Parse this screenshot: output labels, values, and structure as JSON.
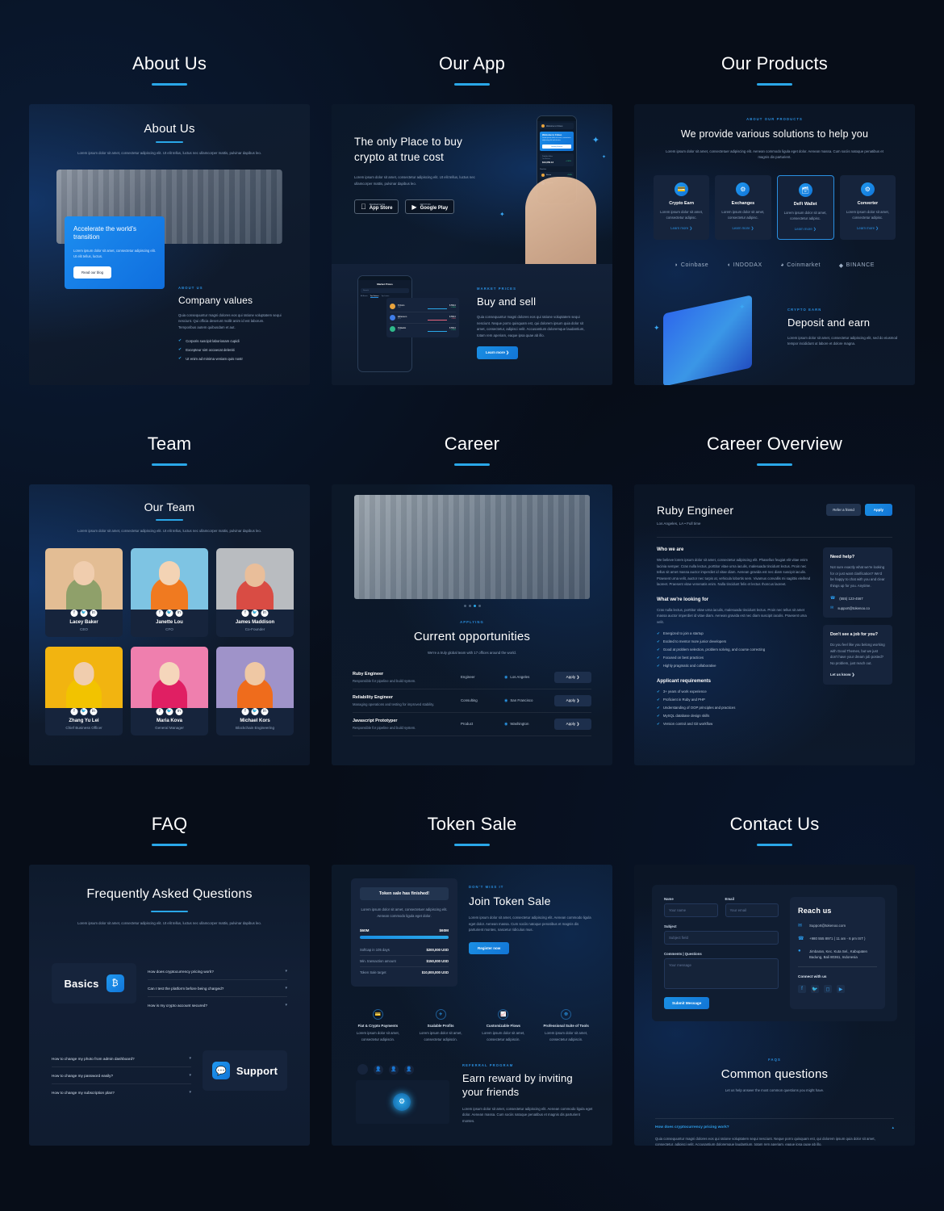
{
  "meta": {
    "accent": "#2aa7e8",
    "blue": "#1a8fe3",
    "bg": "#070d18"
  },
  "sections": [
    {
      "id": "about-us",
      "title": "About Us"
    },
    {
      "id": "our-app",
      "title": "Our App"
    },
    {
      "id": "our-products",
      "title": "Our Products"
    },
    {
      "id": "team",
      "title": "Team"
    },
    {
      "id": "career",
      "title": "Career"
    },
    {
      "id": "career-overview",
      "title": "Career Overview"
    },
    {
      "id": "faq",
      "title": "FAQ"
    },
    {
      "id": "token-sale",
      "title": "Token Sale"
    },
    {
      "id": "contact-us",
      "title": "Contact Us"
    }
  ],
  "lorem": {
    "short": "Lorem ipsum dolor sit amet, consectetur adipiscing elit. Ut elit tellus, luctus nec ullamcorper mattis, pulvinar dapibus leo.",
    "card": "Lorem ipsum dolor sit amet, consectetur adipiscin.",
    "para": "Quia consequuntur magni dolores eos qui ratione voluptatem sequi nesciunt. Qui officia deserunt mollit anim id est laborum. Temporibus autem quibusdam et aut.",
    "para2": "Quia consequuntur magni dolores eos qui ratione voluptatem sequi nesciunt. Neque porro quisquam est, qui dolorem ipsum quia dolor sit amet, consectetur, adipisci velit. Accusantium doloremque laudantium, totam rem aperiam, eaque ipsa quae ab illo.",
    "products": "Lorem ipsum dolor sit amet, consectetuer adipiscing elit. Aenean commodo ligula eget dolor. Aenean massa. Cum sociis natoque penatibus et magnis dis parturient.",
    "smallcard": "Lorem ipsum dolor sit amet, consectetur adipiscin.",
    "blue": "Lorem ipsum dolor sit amet, consectetur adipiscing elit. Ut elit tellus, luctus.",
    "deposit": "Lorem ipsum dolor sit amet, consectetur adipiscing elit, sed do eiusmod tempor incididunt ut labore et dolore magna.",
    "token": "Lorem ipsum dolor sit amet, consectetur adipiscing elit. Aenean commodo ligula eget dolor. Aenean massa. Cum sociis natoque penatibus et magnis dis parturient montes, nascetur ridiculus mus.",
    "tokenbox": "Lorem ipsum dolor sit amet, consectetuer adipiscing elit. Aenean commodo ligula eget dolor.",
    "referral": "Lorem ipsum dolor sit amet, consectetur adipiscing elit. Aenean commodo ligula eget dolor. Aenean massa. Cum sociis natoque penatibus et magnis dis parturient montes.",
    "faqanswer": "Quia consequuntur magni dolores eos qui ratione voluptatem sequi nesciunt. Neque porro quisquam est, qui dolorem ipsum quia dolor sit amet, consectetur, adipisci velit. Accusantium doloremque laudantium, totam rem aperiam, eaque ipsa quae ab illo."
  },
  "about": {
    "heading": "About Us",
    "subtitle": "Lorem ipsum dolor sit amet, consectetur adipiscing elit. Ut elit tellus, luctus nec ullamcorper mattis, pulvinar dapibus leo.",
    "blue_card": {
      "title": "Accelerate the world's transition",
      "body": "Lorem ipsum dolor sit amet, consectetur adipiscing elit. Ut elit tellus, luctus.",
      "button": "Read our blog"
    },
    "eyebrow": "ABOUT US",
    "title": "Company values",
    "body": "Quia consequuntur magni dolores eos qui ratione voluptatem sequi nesciunt. Qui officia deserunt mollit anim id est laborum. Temporibus autem quibusdam et aut.",
    "bullets": [
      "Corporis suscipit laboriosam cupidi",
      "Excepteur sint occaecat deleniti",
      "Ut enim ad minima veniam quis nostr"
    ]
  },
  "app": {
    "hero_title": "The only Place to buy crypto at true cost",
    "hero_body": "Lorem ipsum dolor sit amet, consectetur adipiscing elit. Ut elit tellus, luctus nec ullamcorper mattis, pulvinar dapibus leo.",
    "store_buttons": [
      {
        "small": "Download on the",
        "big": "App Store",
        "icon": "apple-icon"
      },
      {
        "small": "GET IT ON",
        "big": "Google Play",
        "icon": "play-icon"
      }
    ],
    "phone": {
      "welcome_title": "Welcome to Crineo",
      "welcome_body": "Lorem ipsum dolor sit amet, consectetur adipiscing elit sed do eius",
      "welcome_button": "Getting Started",
      "portfolio_label": "Portfolio Value",
      "portfolio_sub": "Total Balance",
      "portfolio_value": "$13,056.12",
      "portfolio_change": "+2.45%",
      "watchlist_label": "Watchlist",
      "coins": [
        {
          "name": "Bitcoin",
          "ticker": "BTC",
          "price": "$ 550.0",
          "change": "+2.06%"
        },
        {
          "name": "Ethereum",
          "ticker": "ETH",
          "price": "$ 550.0",
          "change": "-1.04%"
        }
      ]
    },
    "market": {
      "title": "Market Prices",
      "search_placeholder": "Search",
      "tabs": [
        "All Assets",
        "Top Gainers",
        "Top Losers"
      ],
      "rows": [
        {
          "name": "TriCoin",
          "ticker": "TRC",
          "price": "$ 550.0",
          "change": "+2.06%"
        },
        {
          "name": "Ethereum",
          "ticker": "ETH",
          "price": "$ 550.0",
          "change": "-1.04%"
        },
        {
          "name": "Polkadot",
          "ticker": "DOT",
          "price": "$ 550.0",
          "change": "+2.06%"
        }
      ]
    },
    "section": {
      "eyebrow": "MARKET PRICES",
      "title": "Buy and sell",
      "body": "Quia consequuntur magni dolores eos qui ratione voluptatem sequi nesciunt. Neque porro quisquam est, qui dolorem ipsum quia dolor sit amet, consectetur, adipisci velit. Accusantium doloremque laudantium, totam rem aperiam, eaque ipsa quae ab illo.",
      "button": "Learn more"
    }
  },
  "products": {
    "eyebrow": "ABOUT OUR PRODUCTS",
    "title": "We provide various solutions to help you",
    "body": "Lorem ipsum dolor sit amet, consectetuer adipiscing elit. Aenean commodo ligula eget dolor. Aenean massa. Cum sociis natoque penatibus et magnis dis parturient.",
    "cards": [
      {
        "name": "Crypto Earn",
        "body": "Lorem ipsum dolor sit amet, consectetur adipisc.",
        "link": "Learn more",
        "icon": "wallet-icon",
        "active": false
      },
      {
        "name": "Exchanges",
        "body": "Lorem ipsum dolor sit amet, consectetur adipisc.",
        "link": "Learn more",
        "icon": "exchange-icon",
        "active": false
      },
      {
        "name": "DeFi Wallet",
        "body": "Lorem ipsum dolor sit amet, consectetur adipisc.",
        "link": "Learn more",
        "icon": "safe-icon",
        "active": true
      },
      {
        "name": "Converter",
        "body": "Lorem ipsum dolor sit amet, consectetur adipisc.",
        "link": "Learn more",
        "icon": "convert-icon",
        "active": false
      }
    ],
    "logos": [
      "Coinbase",
      "INDODAX",
      "Coinmarket",
      "BINANCE"
    ],
    "deposit": {
      "eyebrow": "CRYPTO EARN",
      "title": "Deposit and earn",
      "body": "Lorem ipsum dolor sit amet, consectetur adipiscing elit, sed do eiusmod tempor incididunt ut labore et dolore magna."
    }
  },
  "team": {
    "heading": "Our Team",
    "subtitle": "Lorem ipsum dolor sit amet, consectetur adipiscing elit. Ut elit tellus, luctus nec ullamcorper mattis, pulvinar dapibus leo.",
    "members": [
      {
        "name": "Lacey Baker",
        "role": "CEO",
        "bg": "#e3bd94",
        "skin": "#f0cdae",
        "shirt": "#8fa06a"
      },
      {
        "name": "Janette Lou",
        "role": "CFO",
        "bg": "#7ec4e3",
        "skin": "#f3d3b4",
        "shirt": "#f07a20"
      },
      {
        "name": "James Maddison",
        "role": "Co-Founder",
        "bg": "#b9bcc0",
        "skin": "#e9be9a",
        "shirt": "#d94c44"
      },
      {
        "name": "Zhang Yu Lei",
        "role": "Chief Business Officer",
        "bg": "#f2b410",
        "skin": "#f0cdae",
        "shirt": "#f2c300"
      },
      {
        "name": "Maria Kova",
        "role": "General Manager",
        "bg": "#ef7fae",
        "skin": "#f5d6bb",
        "shirt": "#e01f63"
      },
      {
        "name": "Michael Kors",
        "role": "Blockchain Engineering",
        "bg": "#9f93c9",
        "skin": "#efc8a4",
        "shirt": "#ef6c1c"
      }
    ],
    "social_icons": [
      "facebook-icon",
      "twitter-icon",
      "linkedin-icon"
    ]
  },
  "career": {
    "eyebrow": "APPLYING",
    "title": "Current opportunities",
    "subtitle": "We're a truly global team with 17 offices around the world.",
    "jobs": [
      {
        "title": "Ruby Engineer",
        "desc": "Responsible for pipeline and build system.",
        "dept": "Engineer",
        "location": "Los Angeles",
        "button": "Apply"
      },
      {
        "title": "Reliability Engineer",
        "desc": "Managing operations and testing for improved stability.",
        "dept": "Consulting",
        "location": "San Francisco",
        "button": "Apply"
      },
      {
        "title": "Javascript Prototyper",
        "desc": "Responsible for pipeline and build system.",
        "dept": "Product",
        "location": "Washington",
        "button": "Apply"
      }
    ]
  },
  "career_overview": {
    "job_title": "Ruby Engineer",
    "job_meta": "Los Angeles, LA  •  Full time",
    "refer_button": "Refer a friend",
    "apply_button": "Apply",
    "who_title": "Who we are",
    "who_body": "We believe lorem ipsum dolor sit amet, consectetur adipiscing elit. Phasellus feugiat elit vitae enim lacinia semper. Cras nulla lectus, porttitor vitae urna iaculis, malesuada tincidunt lectus. Proin nec tellus sit amet massa auctor imperdiet id vitae diam. Aenean gravida est nec diam suscipit iaculis. Praesent urna velit, auctor nec turpis at, vehicula lobortis sem. Vivamus convallis mi sagittis eleifend laoreet. Praesent vitae venenatis enim. Nulla tincidunt felis et lectus rhoncus laoreet.",
    "looking_title": "What we're looking for",
    "looking_body": "Cras nulla lectus, porttitor vitae urna iaculis, malesuada tincidunt lectus. Proin nec tellus sit amet massa auctor imperdiet id vitae diam. Aenean gravida est nec diam suscipit iaculis. Praesent urna velit.",
    "looking_items": [
      "Energized to join a startup",
      "Excited to mentor more junior developers",
      "Good at problem selection, problem solving, and course correcting",
      "Focused on best practices",
      "Highly pragmatic and collaborative"
    ],
    "req_title": "Applicant requirements",
    "req_items": [
      "3+ years of work experience",
      "Proficient in Ruby and PHP",
      "Understanding of OOP principles and practices",
      "MySQL database design skills",
      "Version control and Git workflow"
    ],
    "help_title": "Need help?",
    "help_body": "Not sure exactly what we're looking for or just want clarification? We'd be happy to chat with you and clear things up for you. Anytime.",
    "help_phone": "(555) 123-4567",
    "help_email": "support@tokenoo.co",
    "nojob_title": "Don't see a job for you?",
    "nojob_body": "Do you feel like you belong working with Good Themes, but we just don't have your dream job posted? No problem, just reach out.",
    "nojob_link": "Let us know"
  },
  "faq": {
    "heading": "Frequently Asked Questions",
    "subtitle": "Lorem ipsum dolor sit amet, consectetur adipiscing elit. Ut elit tellus, luctus nec ullamcorper mattis, pulvinar dapibus leo.",
    "basics_label": "Basics",
    "basics_icon": "bitcoin-icon",
    "basics_questions": [
      "How does cryptocurrency pricing work?",
      "Can I test the platform before being charged?",
      "How is my crypto account secured?"
    ],
    "support_label": "Support",
    "support_icon": "chat-help-icon",
    "support_questions": [
      "How to change my photo from admin dashboard?",
      "How to change my password easily?",
      "How to change my subscription plan?"
    ]
  },
  "token_sale": {
    "box": {
      "badge": "Token sale has finished!",
      "body": "Lorem ipsum dolor sit amet, consectetuer adipiscing elit. Aenean commodo ligula eget dolor.",
      "progress_left": "$60M",
      "progress_right": "$60M",
      "progress_percent": 100,
      "stats": [
        {
          "label": "Softcap in 105 days",
          "value": "$200,000 USD"
        },
        {
          "label": "Min. transaction amount",
          "value": "$150,000 USD"
        },
        {
          "label": "Token Sale target",
          "value": "$10,000,000 USD"
        }
      ]
    },
    "eyebrow": "DON'T MISS IT",
    "title": "Join Token Sale",
    "body": "Lorem ipsum dolor sit amet, consectetur adipiscing elit. Aenean commodo ligula eget dolor. Aenean massa. Cum sociis natoque penatibus et magnis dis parturient montes, nascetur ridiculus mus.",
    "button": "Register now",
    "features": [
      {
        "name": "Fiat & Crypto Payments",
        "body": "Lorem ipsum dolor sit amet, consectetur adipiscin.",
        "icon": "card-icon"
      },
      {
        "name": "Scalable Profits",
        "body": "Lorem ipsum dolor sit amet, consectetur adipiscin.",
        "icon": "rocket-icon"
      },
      {
        "name": "Customizable Flows",
        "body": "Lorem ipsum dolor sit amet, consectetur adipiscin.",
        "icon": "chart-icon"
      },
      {
        "name": "Professional Suite of Tools",
        "body": "Lorem ipsum dolor sit amet, consectetur adipiscin.",
        "icon": "puzzle-icon"
      }
    ],
    "referral": {
      "eyebrow": "REFERRAL PROGRAM",
      "title": "Earn reward by inviting your friends",
      "body": "Lorem ipsum dolor sit amet, consectetur adipiscing elit. Aenean commodo ligula eget dolor. Aenean massa. Cum sociis natoque penatibus et magnis dis parturient montes."
    }
  },
  "contact": {
    "form": {
      "name_label": "Name",
      "name_placeholder": "Your name",
      "email_label": "Email",
      "email_placeholder": "Your email",
      "subject_label": "Subject",
      "subject_placeholder": "Subject field",
      "message_label": "Comments | Questions",
      "message_placeholder": "Your message",
      "submit": "Submit Message"
    },
    "reach": {
      "title": "Reach us",
      "email": "Support@tokenoo.com",
      "phone": "+980 555 8971 ( 11 am - 6 pm IST )",
      "address": "Jimbaran, Kec. Kuta Sel., Kabupaten Badung, Bali 80361, Indonesia",
      "connect_label": "Connect with us",
      "socials": [
        "facebook-icon",
        "twitter-icon",
        "instagram-icon",
        "youtube-icon"
      ]
    },
    "faq": {
      "eyebrow": "FAQS",
      "title": "Common questions",
      "subtitle": "Let us help answer the most common questions you might have.",
      "open_question": "How does cryptocurrency pricing work?",
      "open_answer": "Quia consequuntur magni dolores eos qui ratione voluptatem sequi nesciunt. Neque porro quisquam est, qui dolorem ipsum quia dolor sit amet, consectetur, adipisci velit. Accusantium doloremque laudantium, totam rem aperiam, eaque ipsa quae ab illo."
    }
  }
}
